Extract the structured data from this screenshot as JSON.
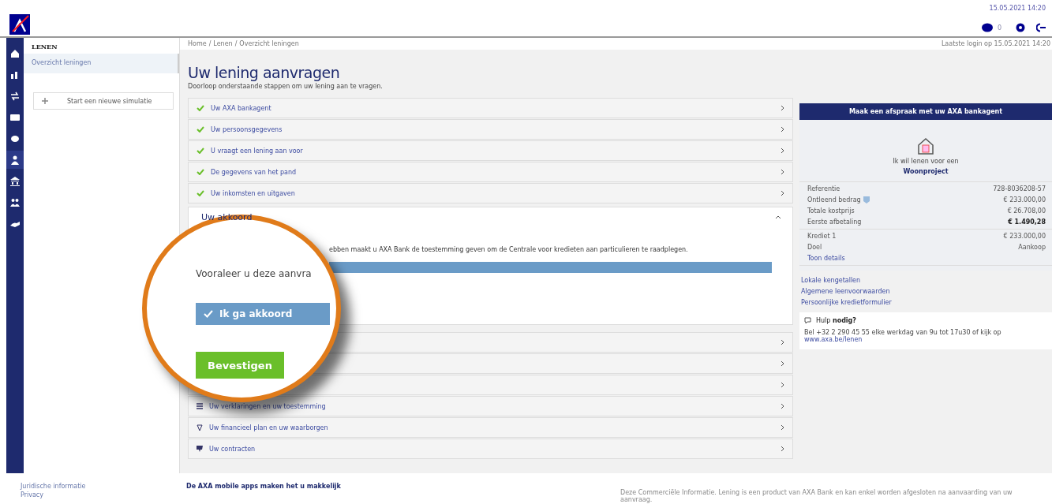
{
  "header": {
    "datetime": "15.05.2021 14:20",
    "message_count": "0"
  },
  "nav": [
    {
      "kind": "home",
      "selected": false
    },
    {
      "kind": "chart",
      "selected": false
    },
    {
      "kind": "transfer",
      "selected": false
    },
    {
      "kind": "card",
      "selected": false
    },
    {
      "kind": "piggy",
      "selected": false
    },
    {
      "kind": "person",
      "selected": true
    },
    {
      "kind": "bank",
      "selected": false
    },
    {
      "kind": "people",
      "selected": false
    },
    {
      "kind": "hand",
      "selected": false
    }
  ],
  "sidebar": {
    "heading": "LENEN",
    "items": [
      {
        "label": "Overzicht leningen",
        "selected": true
      }
    ],
    "button": "Start een nieuwe simulatie"
  },
  "breadcrumb": [
    "Home",
    "Lenen",
    "Overzicht leningen"
  ],
  "breadcrumb_separator": "/",
  "last_login": "Laatste login op 15.05.2021 14:20",
  "title": "Uw lening aanvragen",
  "subtitle": "Doorloop onderstaande stappen om uw lening aan te vragen.",
  "steps_done": [
    {
      "label": "Uw AXA bankagent",
      "done": true
    },
    {
      "label": "Uw persoonsgegevens",
      "done": true
    },
    {
      "label": "U vraagt een lening aan voor",
      "done": true
    },
    {
      "label": "De gegevens van het pand",
      "done": true
    },
    {
      "label": "Uw inkomsten en uitgaven",
      "done": true
    }
  ],
  "agreement": {
    "title": "Uw akkoord",
    "expanded": true,
    "text": "ebben maakt u AXA Bank de toestemming geven om de Centrale voor kredieten aan particulieren te raadplegen.",
    "lens_text": "Vooraleer u deze aanvra",
    "agree_button": "Ik ga akkoord",
    "agreed": true,
    "confirm_button": "Bevestigen"
  },
  "steps_next": [
    {
      "kind": "plain"
    },
    {
      "kind": "plain"
    },
    {
      "kind": "plain"
    },
    {
      "kind": "list",
      "label": "Uw verklaringen en uw toestemming"
    },
    {
      "kind": "gift",
      "label": "Uw financieel plan en uw waarborgen"
    },
    {
      "kind": "thumb",
      "label": "Uw contracten"
    }
  ],
  "aside": {
    "banner": "Maak een afspraak met uw AXA bankagent",
    "purpose_line": "Ik wil lenen voor een",
    "purpose": "Woonproject",
    "details": [
      {
        "label": "Referentie",
        "value": "728-8036208-57",
        "bold": false
      },
      {
        "label": "Ontleend bedrag",
        "value": "€ 233.000,00",
        "info": true,
        "bold": false
      },
      {
        "label": "Totale kostprijs",
        "value": "€ 26.708,00",
        "bold": false
      },
      {
        "label": "Eerste afbetaling",
        "value": "€ 1.490,28",
        "bold": true
      }
    ],
    "details2": [
      {
        "label": "Krediet 1",
        "value": "€ 233.000,00"
      },
      {
        "label": "Doel",
        "value": "Aankoop"
      }
    ],
    "toggle": "Toon details",
    "links": [
      "Lokale kengetallen",
      "Algemene leenvoorwaarden",
      "Persoonlijke kredietformulier"
    ],
    "help_title": "Hulp **nodig?**",
    "help_text": "Bel +32 2 290 45 55 elke werkdag van 9u tot 17u30 of kijk op",
    "help_link": "www.axa.be/lenen"
  },
  "footer": {
    "links": [
      "Juridische informatie",
      "Privacy"
    ],
    "apps": "De AXA mobile apps maken het u makkelijk",
    "note": "Deze Commerciële Informatie. Lening is een product van AXA Bank en kan enkel worden afgesloten na aanvaarding van uw aanvraag."
  }
}
